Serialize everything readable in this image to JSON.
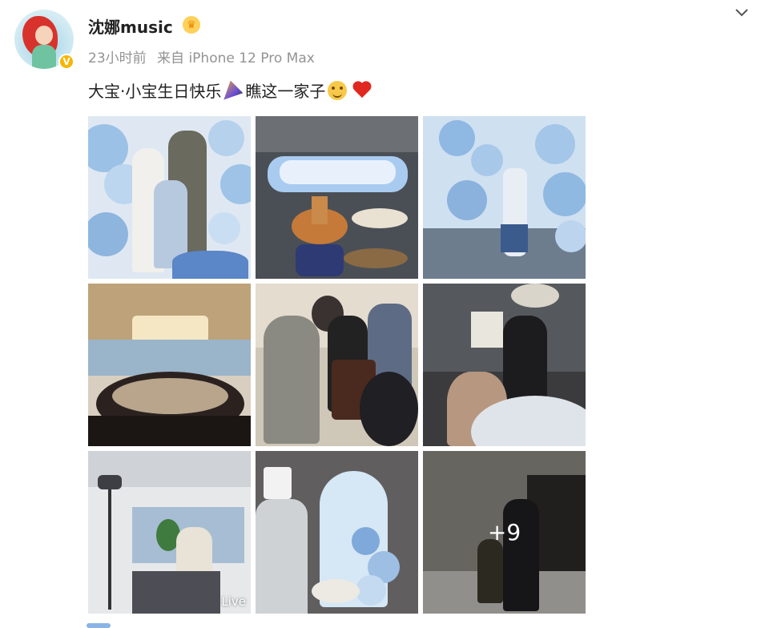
{
  "post": {
    "username": "沈娜music",
    "time": "23小时前",
    "source": "来自 iPhone 12 Pro Max",
    "text_part1": "大宝·小宝生日快乐",
    "text_part2": "瞧这一家子",
    "more_count": "+9",
    "live_label": "Live",
    "verified_badge": "V"
  },
  "icons": [
    "avatar",
    "verified-badge-icon",
    "crown-icon",
    "chevron-down-icon",
    "party-popper-icon",
    "smiling-face-icon",
    "red-heart-icon"
  ],
  "colors": {
    "username": "#222222",
    "meta": "#939393",
    "verified": "#f7b500",
    "heart": "#e0281f"
  }
}
